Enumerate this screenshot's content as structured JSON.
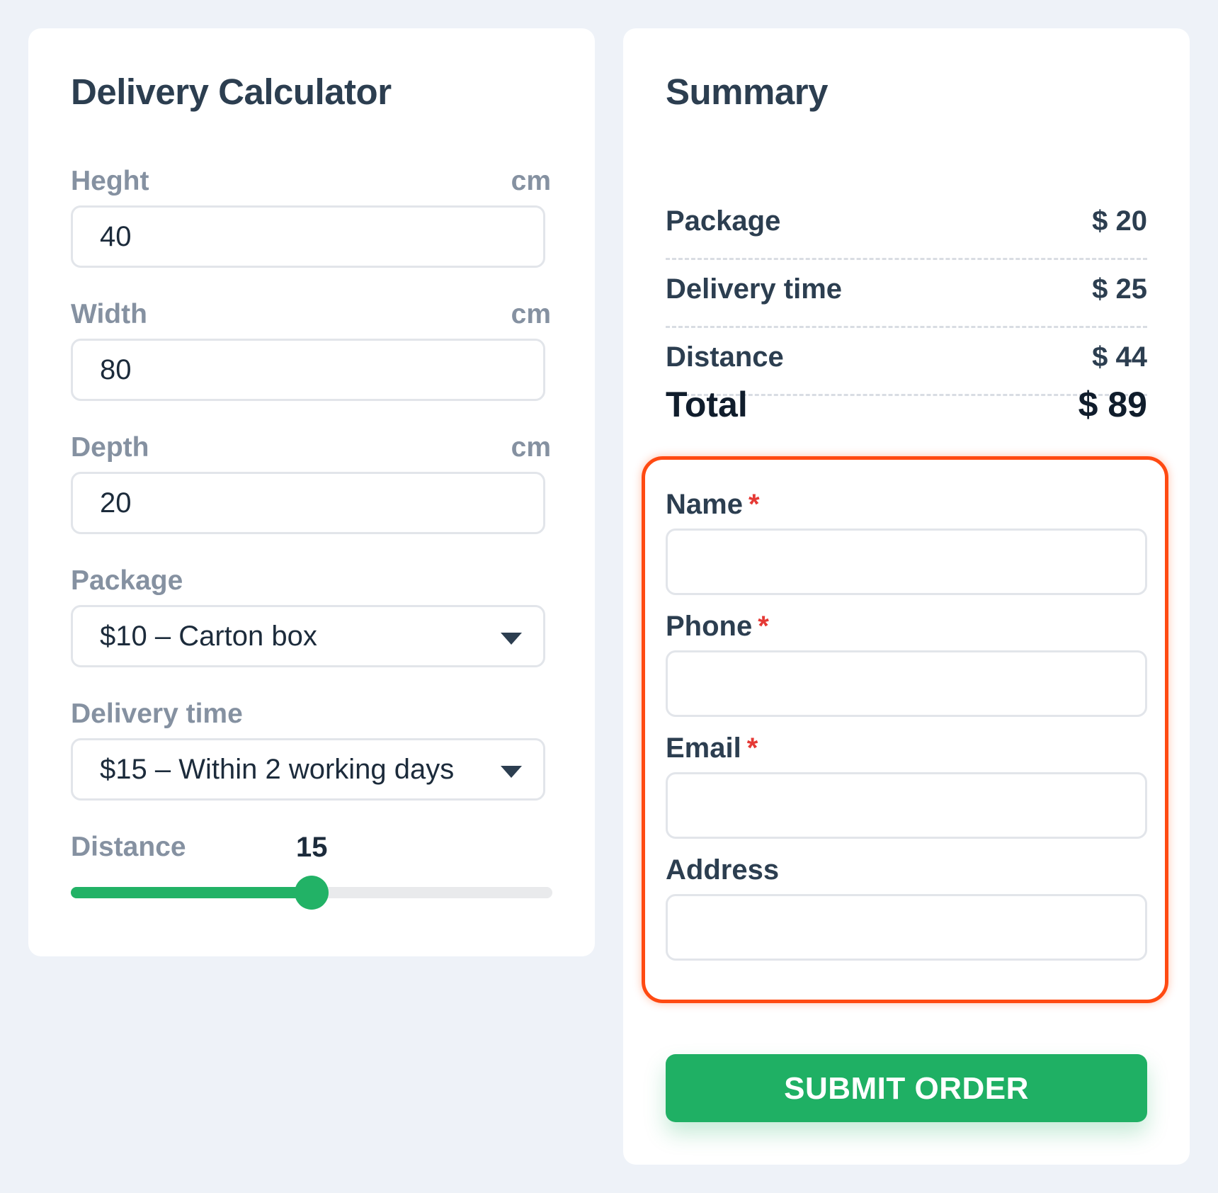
{
  "calculator": {
    "title": "Delivery Calculator",
    "height": {
      "label": "Heght",
      "unit": "cm",
      "value": "40"
    },
    "width": {
      "label": "Width",
      "unit": "cm",
      "value": "80"
    },
    "depth": {
      "label": "Depth",
      "unit": "cm",
      "value": "20"
    },
    "package": {
      "label": "Package",
      "selected": "$10 – Carton box"
    },
    "delivery_time": {
      "label": "Delivery time",
      "selected": "$15 – Within 2 working days"
    },
    "distance": {
      "label": "Distance",
      "value": "15",
      "fraction": 0.5
    }
  },
  "summary": {
    "title": "Summary",
    "rows": [
      {
        "label": "Package",
        "value": "$ 20"
      },
      {
        "label": "Delivery time",
        "value": "$ 25"
      },
      {
        "label": "Distance",
        "value": "$ 44"
      }
    ],
    "total_label": "Total",
    "total_value": "$ 89"
  },
  "form": {
    "required_mark": "*",
    "name_label": "Name",
    "phone_label": "Phone",
    "email_label": "Email",
    "address_label": "Address"
  },
  "submit_label": "SUBMIT ORDER",
  "colors": {
    "accent_green": "#1fb064",
    "highlight_orange": "#ff4a12",
    "required_red": "#e53935"
  }
}
